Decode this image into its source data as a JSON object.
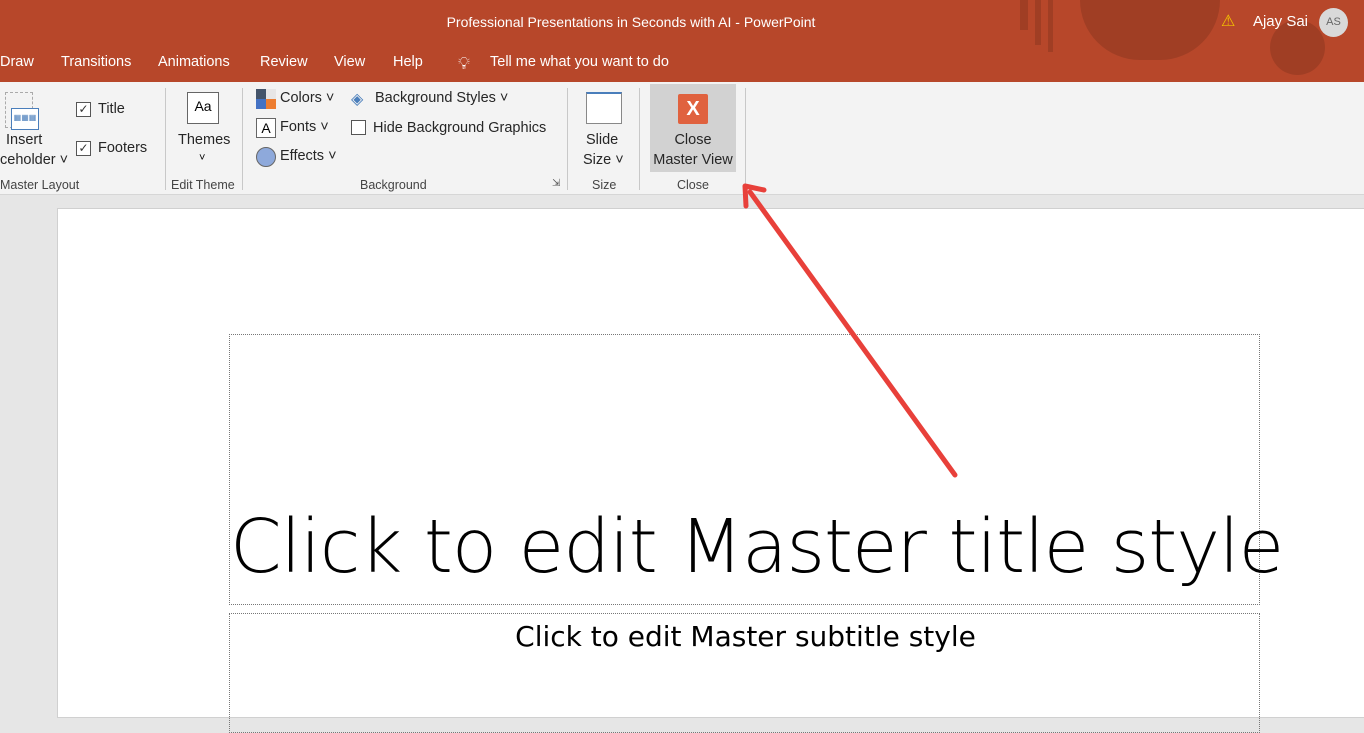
{
  "window": {
    "title": "Professional Presentations in Seconds with AI  -  PowerPoint",
    "user_name": "Ajay Sai",
    "user_initials": "AS"
  },
  "tabs": [
    "Draw",
    "Transitions",
    "Animations",
    "Review",
    "View",
    "Help"
  ],
  "tell_me": "Tell me what you want to do",
  "ribbon": {
    "master_layout": {
      "insert_line1": "Insert",
      "insert_line2": "ceholder",
      "title_cb": "Title",
      "footers_cb": "Footers",
      "group": "Master Layout"
    },
    "edit_theme": {
      "themes": "Themes",
      "group": "Edit Theme"
    },
    "background": {
      "colors": "Colors",
      "fonts": "Fonts",
      "effects": "Effects",
      "bg_styles": "Background Styles",
      "hide_bg": "Hide Background Graphics",
      "group": "Background"
    },
    "size": {
      "line1": "Slide",
      "line2": "Size",
      "group": "Size"
    },
    "close": {
      "line1": "Close",
      "line2": "Master View",
      "group": "Close"
    }
  },
  "slide": {
    "title": "Click to edit Master title style",
    "subtitle": "Click to edit Master subtitle style"
  },
  "colors": {
    "accent": "#b7472a",
    "arrow": "#e8403a"
  }
}
